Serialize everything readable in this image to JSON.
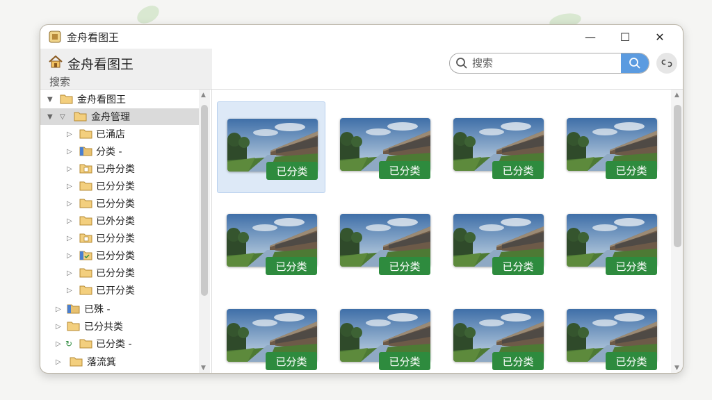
{
  "window": {
    "title": "金舟看图王",
    "controls": {
      "minimize": "—",
      "maximize": "☐",
      "close": "✕"
    }
  },
  "left_header": {
    "title": "金舟看图王",
    "subtitle": "搜索"
  },
  "search": {
    "placeholder": "搜索",
    "value": ""
  },
  "tree": {
    "items": [
      {
        "label": "金舟看图王",
        "expanded": true,
        "icon": "folder-icon"
      },
      {
        "label": "金舟管理",
        "expanded": true,
        "selected": true,
        "icon": "folder-icon"
      },
      {
        "label": "已涌店",
        "icon": "folder-icon"
      },
      {
        "label": "分类 -",
        "icon": "folder-blue-icon"
      },
      {
        "label": "已舟分类",
        "icon": "folder-doc-icon"
      },
      {
        "label": "已分分类",
        "icon": "folder-icon"
      },
      {
        "label": "已分分类",
        "icon": "folder-icon"
      },
      {
        "label": "已外分类",
        "icon": "folder-icon"
      },
      {
        "label": "已分分类",
        "icon": "folder-doc-icon"
      },
      {
        "label": "已分分类",
        "icon": "folder-check-icon"
      },
      {
        "label": "已分分类",
        "icon": "folder-icon"
      },
      {
        "label": "已开分类",
        "icon": "folder-icon"
      },
      {
        "label": "已殊 -",
        "icon": "folder-blue-icon"
      },
      {
        "label": "已分共类",
        "icon": "folder-icon"
      },
      {
        "label": "已分类 -",
        "icon": "folder-icon"
      },
      {
        "label": "落流箕",
        "icon": "folder-icon"
      }
    ]
  },
  "grid": {
    "badge_label": "已分类",
    "images": [
      {
        "badge": "已分类",
        "selected": true
      },
      {
        "badge": "已分类"
      },
      {
        "badge": "已分类"
      },
      {
        "badge": "已分类"
      },
      {
        "badge": "已分类"
      },
      {
        "badge": "已分类"
      },
      {
        "badge": "已分类"
      },
      {
        "badge": "已分类"
      },
      {
        "badge": "已分类"
      },
      {
        "badge": "已分类"
      },
      {
        "badge": "已分类"
      },
      {
        "badge": "已分类"
      }
    ]
  },
  "colors": {
    "accent": "#5b9be0",
    "badge": "#2e8b3e",
    "selection": "#dde9f7",
    "folder": "#e8c170"
  }
}
